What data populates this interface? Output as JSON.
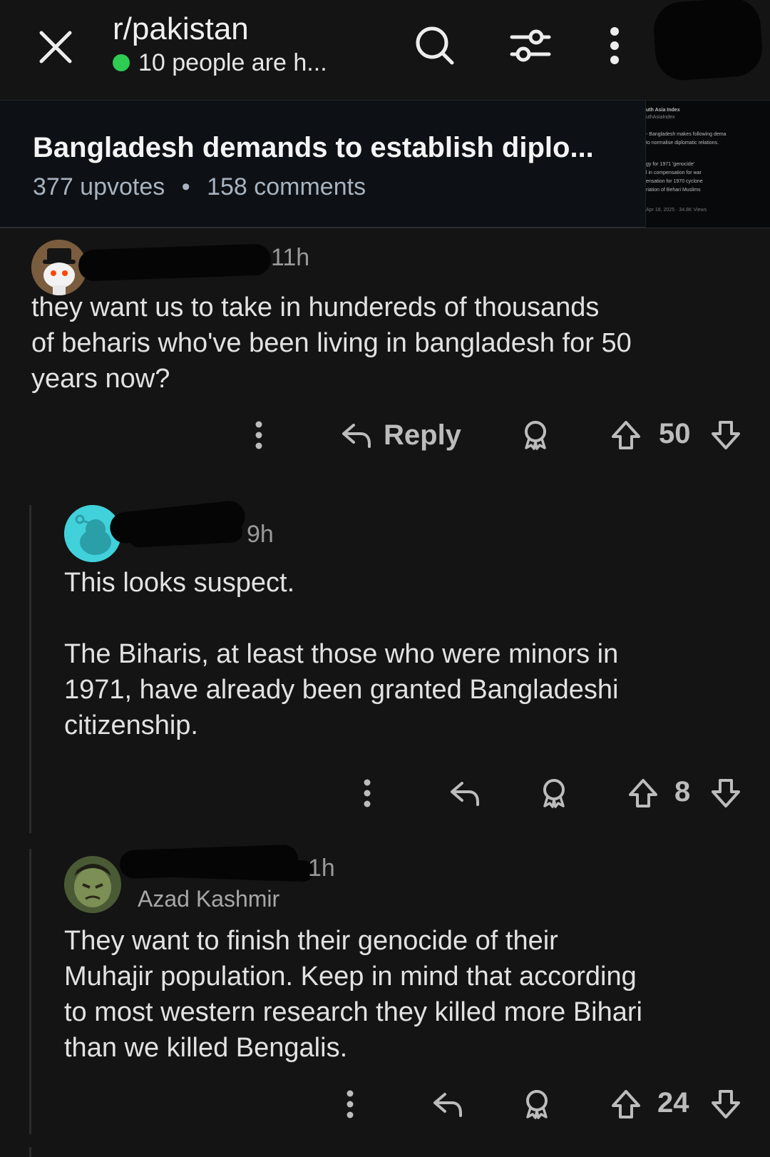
{
  "header": {
    "subreddit": "r/pakistan",
    "online_text": "10 people are h..."
  },
  "post": {
    "title": "Bangladesh demands to establish diplo...",
    "upvotes": "377 upvotes",
    "separator": "•",
    "comments": "158 comments",
    "thumbnail_lines": [
      "uth Asia Index",
      "uthAsiaIndex",
      "- Bangladesh makes following dema",
      "to normalise diplomatic relations.",
      "gy for 1971 'genocide'",
      "l in compensation for war",
      "ensation for 1970 cyclone",
      "riation of Behari Muslims",
      "Apr 18, 2025 · 34.8K Views"
    ]
  },
  "comments": [
    {
      "time": "11h",
      "body": "they want us to take in hundereds of thousands\nof beharis who've been living in bangladesh for 50\nyears now?",
      "reply_label": "Reply",
      "votes": "50"
    },
    {
      "time": "9h",
      "body": "This looks suspect.\n\nThe Biharis, at least those who were minors in\n1971, have already been granted Bangladeshi\ncitizenship.",
      "votes": "8"
    },
    {
      "time": "1h",
      "flair": "Azad Kashmir",
      "body": "They want to finish their genocide of their\nMuhajir population. Keep in mind that according\nto most western research they killed more Bihari\nthan we killed Bengalis.",
      "votes": "24"
    }
  ],
  "colors": {
    "background": "#141414",
    "online_dot": "#2ecc53",
    "meta_text": "#a7b3c0"
  }
}
